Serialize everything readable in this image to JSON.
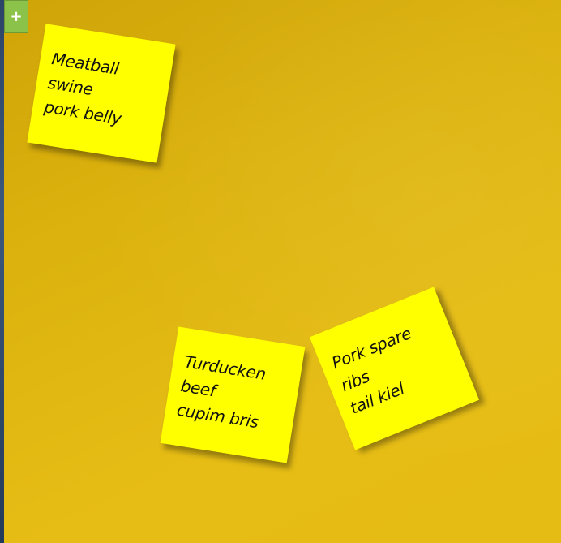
{
  "toolbar": {
    "add_label": "+",
    "add_color": "#8bc34a"
  },
  "board": {
    "background_color": "#e0b711",
    "note_color": "#ffff00"
  },
  "notes": [
    {
      "text": "Meatball swine\npork belly"
    },
    {
      "text": "Turducken beef\ncupim bris"
    },
    {
      "text": "Pork spare ribs\ntail kiel"
    }
  ]
}
